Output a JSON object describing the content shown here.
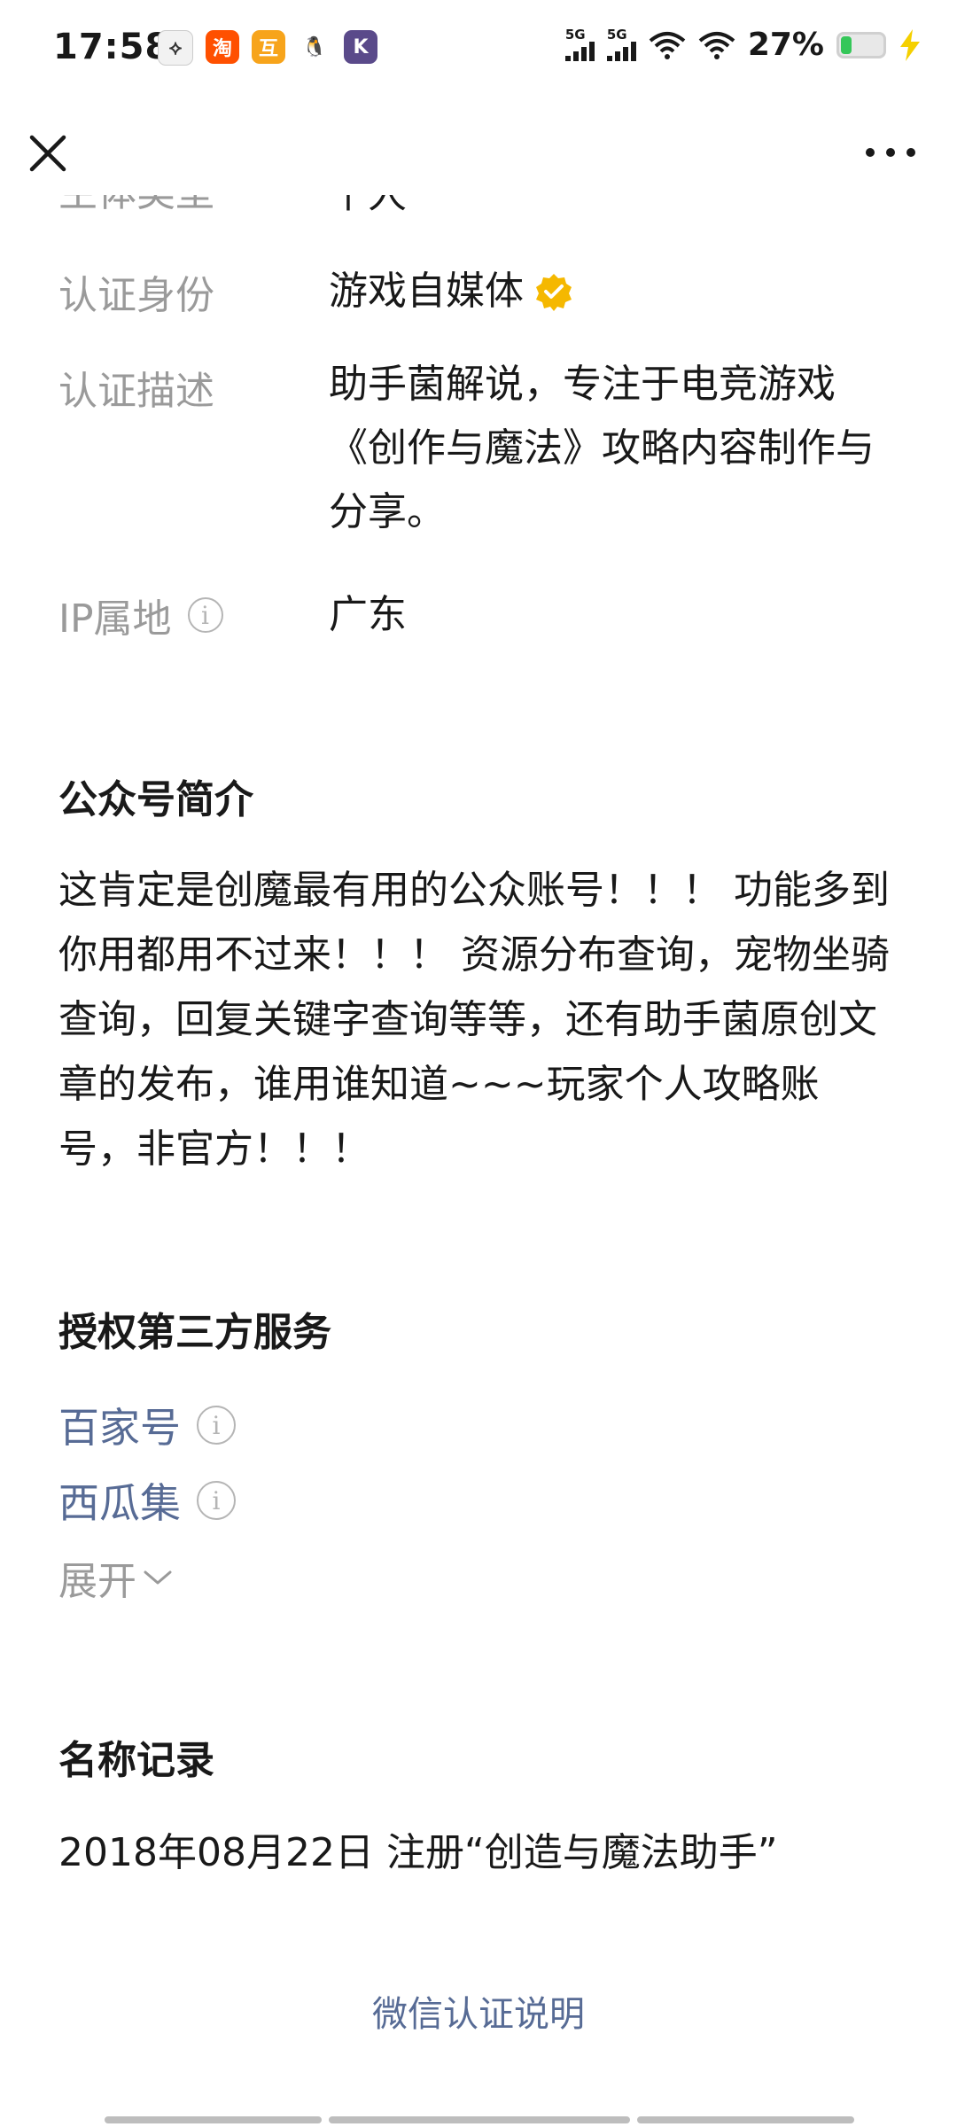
{
  "status_bar": {
    "time": "17:58",
    "app_icons": [
      {
        "name": "app1-icon",
        "glyph": "⟡"
      },
      {
        "name": "taobao-icon",
        "glyph": "淘"
      },
      {
        "name": "app3-icon",
        "glyph": "互"
      },
      {
        "name": "qq-icon",
        "glyph": "🐧"
      },
      {
        "name": "app5-icon",
        "glyph": "K"
      }
    ],
    "signal1_label": "5G",
    "signal2_label": "5G",
    "battery_percent": "27%"
  },
  "nav": {
    "close_icon": "close-icon",
    "more_icon": "more-icon"
  },
  "info": {
    "partial_row_label": "主体类型",
    "partial_row_value": "个人",
    "verify_label": "认证身份",
    "verify_value": "游戏自媒体",
    "desc_label": "认证描述",
    "desc_value": "助手菌解说，专注于电竞游戏《创作与魔法》攻略内容制作与分享。",
    "ip_label": "IP属地",
    "ip_value": "广东"
  },
  "intro": {
    "title": "公众号简介",
    "text": "这肯定是创魔最有用的公众账号！！！ 功能多到你用都用不过来！！！ 资源分布查询，宠物坐骑查询，回复关键字查询等等，还有助手菌原创文章的发布，谁用谁知道~~~玩家个人攻略账号，非官方！！！"
  },
  "services": {
    "title": "授权第三方服务",
    "items": [
      "百家号",
      "西瓜集"
    ],
    "expand_label": "展开"
  },
  "name_history": {
    "title": "名称记录",
    "record": "2018年08月22日 注册“创造与魔法助手”"
  },
  "footer": {
    "link": "微信认证说明"
  },
  "colors": {
    "link": "#576b95",
    "label_gray": "#9a9a9a",
    "badge_gold": "#f5b800",
    "battery_green": "#35c759"
  }
}
